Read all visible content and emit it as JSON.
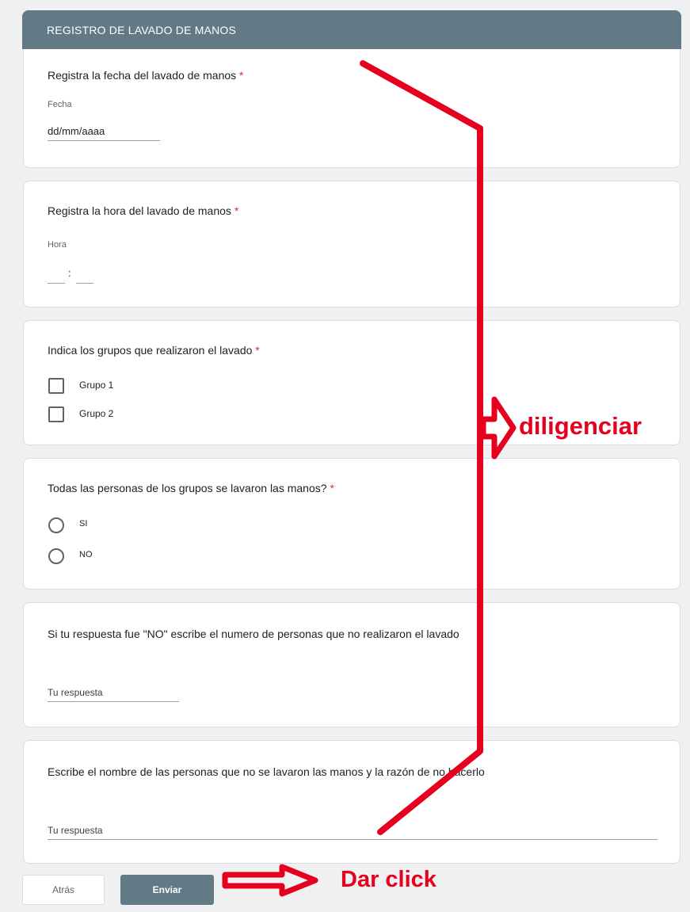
{
  "form": {
    "title": "REGISTRO DE LAVADO DE MANOS",
    "required_mark": "*"
  },
  "questions": {
    "fecha": {
      "label": "Registra la fecha del lavado de manos",
      "sublabel": "Fecha",
      "placeholder": "dd/mm/aaaa"
    },
    "hora": {
      "label": "Registra la hora del lavado de manos",
      "sublabel": "Hora",
      "separator": ":"
    },
    "grupos": {
      "label": "Indica los grupos que realizaron el lavado",
      "options": [
        "Grupo 1",
        "Grupo 2"
      ]
    },
    "todas": {
      "label": "Todas las personas de los grupos se lavaron las manos?",
      "options": [
        "SI",
        "NO"
      ]
    },
    "numero": {
      "label": "Si tu respuesta fue \"NO\" escribe el numero de personas que no realizaron el lavado",
      "placeholder": "Tu respuesta"
    },
    "nombres": {
      "label": "Escribe el nombre de las personas que no se lavaron las manos y la razón de no hacerlo",
      "placeholder": "Tu respuesta"
    }
  },
  "buttons": {
    "back": "Atrás",
    "submit": "Enviar"
  },
  "annotations": {
    "fill": "diligenciar",
    "click": "Dar click",
    "color": "#e6001e"
  }
}
